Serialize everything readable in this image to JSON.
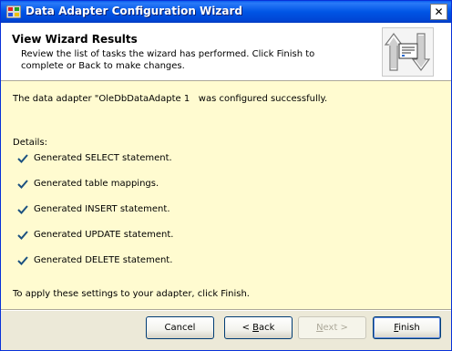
{
  "window": {
    "title": "Data Adapter Configuration Wizard",
    "close_glyph": "✕"
  },
  "header": {
    "title": "View Wizard Results",
    "description_line1": "Review the list of tasks the wizard has performed. Click Finish to",
    "description_line2": "complete or Back to make changes."
  },
  "content": {
    "status_message": "The data adapter \"OleDbDataAdapte 1   was configured successfully.",
    "details_label": "Details:",
    "tasks": [
      "Generated SELECT statement.",
      "Generated table mappings.",
      "Generated INSERT statement.",
      "Generated UPDATE statement.",
      "Generated DELETE statement."
    ],
    "footer_message": "To apply these settings to your adapter, click Finish."
  },
  "buttons": {
    "cancel": "Cancel",
    "back_prefix": "< ",
    "back_accel": "B",
    "back_rest": "ack",
    "next_prefix": "",
    "next_accel": "N",
    "next_rest": "ext >",
    "finish_accel": "F",
    "finish_rest": "inish"
  },
  "colors": {
    "titlebar": "#0055e5",
    "content_bg": "#fffbd0",
    "check": "#1c5180"
  }
}
